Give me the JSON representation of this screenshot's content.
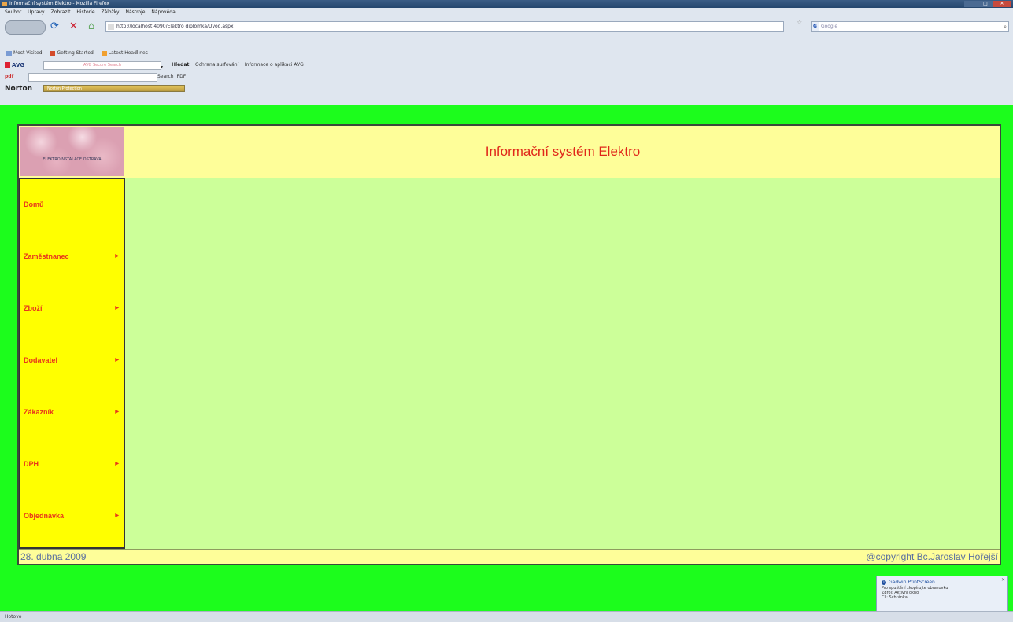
{
  "window": {
    "title": "Informační systém Elektro - Mozilla Firefox",
    "min": "_",
    "max": "□",
    "close": "✕"
  },
  "menubar": [
    "Soubor",
    "Úpravy",
    "Zobrazit",
    "Historie",
    "Záložky",
    "Nástroje",
    "Nápověda"
  ],
  "nav": {
    "back_label": "",
    "url": "http://localhost:4090/Elektro diplomka/Uvod.aspx",
    "search_placeholder": "Google",
    "search_engine": "G"
  },
  "bookmarks": [
    "Most Visited",
    "Getting Started",
    "Latest Headlines"
  ],
  "avg_toolbar": {
    "logo": "AVG",
    "search_placeholder": "AVG Secure Search",
    "links": [
      "Hledat",
      "Ochrana surfování",
      "Informace o aplikaci AVG"
    ]
  },
  "pdf_toolbar": {
    "logo": "pdf",
    "links": [
      "Search",
      "PDF"
    ]
  },
  "norton_toolbar": {
    "logo": "Norton",
    "security_label": "Norton Protection"
  },
  "site": {
    "logo_text": "ELEKTROINSTALACE OSTRAVA",
    "title": "Informační systém Elektro",
    "menu": [
      {
        "label": "Domů",
        "submenu": false
      },
      {
        "label": "Zaměstnanec",
        "submenu": true
      },
      {
        "label": "Zboží",
        "submenu": true
      },
      {
        "label": "Dodavatel",
        "submenu": true
      },
      {
        "label": "Zákazník",
        "submenu": true
      },
      {
        "label": "DPH",
        "submenu": true
      },
      {
        "label": "Objednávka",
        "submenu": true
      }
    ],
    "footer_date": "28. dubna 2009",
    "footer_copyright": "@copyright  Bc.Jaroslav Hořejší"
  },
  "notification": {
    "title": "Gadwin PrintScreen",
    "lines": [
      "Pro spuštění zkopírujte obrazovku",
      "Zdroj: Aktivní okno",
      "Cíl: Schránka"
    ]
  },
  "statusbar": {
    "text": "Hotovo"
  },
  "colors": {
    "page_background": "#1cfd1c",
    "header_background": "#fefe99",
    "content_background": "#ccff99",
    "sidebar_background": "#ffff00",
    "title_text": "#e0281a",
    "menu_text": "#e8351c",
    "footer_text": "#5a6fa0"
  }
}
